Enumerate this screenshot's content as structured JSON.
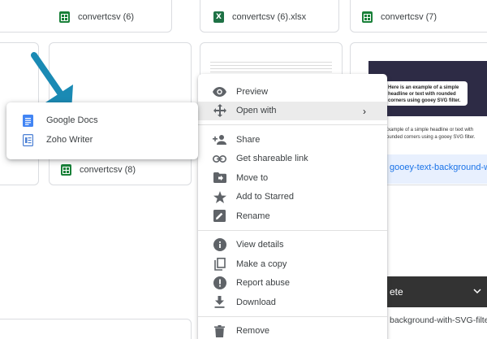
{
  "files": {
    "top_row": [
      {
        "name": "convertcsv (6)",
        "type": "sheets"
      },
      {
        "name": "convertcsv (6).xlsx",
        "type": "excel"
      },
      {
        "name": "convertcsv (7)",
        "type": "sheets"
      }
    ],
    "second_row_name": "convertcsv (8)",
    "selected_file_name": "gooey-text-background-with-",
    "thumbnail_headline": "Here is an example of a simple headline or text with rounded corners using gooey SVG filter.",
    "thumbnail_caption": "Example of a simple headline or text with rounded corners using a gooey SVG filter.",
    "bottom_file_name": "background-with-SVG-filters.p"
  },
  "toast": {
    "label": "ete",
    "chevron_icon": "chevron-down-icon"
  },
  "context_menu": {
    "items": [
      {
        "label": "Preview",
        "icon": "eye-icon"
      },
      {
        "label": "Open with",
        "icon": "open-with-icon",
        "submenu_indicator": "›"
      },
      {
        "label": "Share",
        "icon": "add-person-icon"
      },
      {
        "label": "Get shareable link",
        "icon": "link-icon"
      },
      {
        "label": "Move to",
        "icon": "folder-move-icon"
      },
      {
        "label": "Add to Starred",
        "icon": "star-icon"
      },
      {
        "label": "Rename",
        "icon": "pencil-icon"
      },
      {
        "label": "View details",
        "icon": "info-icon"
      },
      {
        "label": "Make a copy",
        "icon": "copy-icon"
      },
      {
        "label": "Report abuse",
        "icon": "alert-icon"
      },
      {
        "label": "Download",
        "icon": "download-icon"
      },
      {
        "label": "Remove",
        "icon": "trash-icon"
      }
    ]
  },
  "open_with_submenu": {
    "items": [
      {
        "label": "Google Docs",
        "icon": "google-docs-icon"
      },
      {
        "label": "Zoho Writer",
        "icon": "zoho-writer-icon"
      }
    ]
  },
  "colors": {
    "arrow": "#1a8ab4",
    "highlight": "#ebebeb",
    "link": "#1a73e8",
    "sheets_green": "#188038",
    "docs_blue": "#4285f4"
  }
}
